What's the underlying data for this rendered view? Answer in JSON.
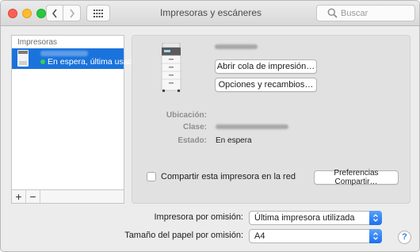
{
  "window": {
    "title": "Impresoras y escáneres"
  },
  "toolbar": {
    "search_placeholder": "Buscar"
  },
  "sidebar": {
    "header": "Impresoras",
    "printers": [
      {
        "status": "En espera, última usada",
        "status_color": "#33d14b",
        "selected": true
      }
    ],
    "add_label": "+",
    "remove_label": "−"
  },
  "detail": {
    "open_queue_button": "Abrir cola de impresión…",
    "options_button": "Opciones y recambios…",
    "location_label": "Ubicación:",
    "location_value": "",
    "class_label": "Clase:",
    "status_label": "Estado:",
    "status_value": "En espera",
    "share_checkbox_label": "Compartir esta impresora en la red",
    "share_checked": false,
    "share_prefs_button": "Preferencias Compartir…"
  },
  "defaults": {
    "default_printer_label": "Impresora por omisión:",
    "default_printer_value": "Última impresora utilizada",
    "paper_size_label": "Tamaño del papel por omisión:",
    "paper_size_value": "A4",
    "help_label": "?"
  },
  "colors": {
    "selection": "#1a73dc",
    "popup_accent": "#1c6ff0"
  }
}
